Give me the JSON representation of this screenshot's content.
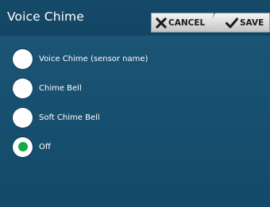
{
  "header": {
    "title": "Voice Chime",
    "cancel_label": "CANCEL",
    "save_label": "SAVE"
  },
  "options": [
    {
      "label": "Voice Chime (sensor name)",
      "selected": false
    },
    {
      "label": "Chime Bell",
      "selected": false
    },
    {
      "label": "Soft Chime Bell",
      "selected": false
    },
    {
      "label": "Off",
      "selected": true
    }
  ],
  "colors": {
    "background": "#185071",
    "selected_dot": "#17a84a",
    "button_text": "#1b1b1b"
  },
  "icons": {
    "cancel": "close-x-icon",
    "save": "checkmark-icon"
  }
}
